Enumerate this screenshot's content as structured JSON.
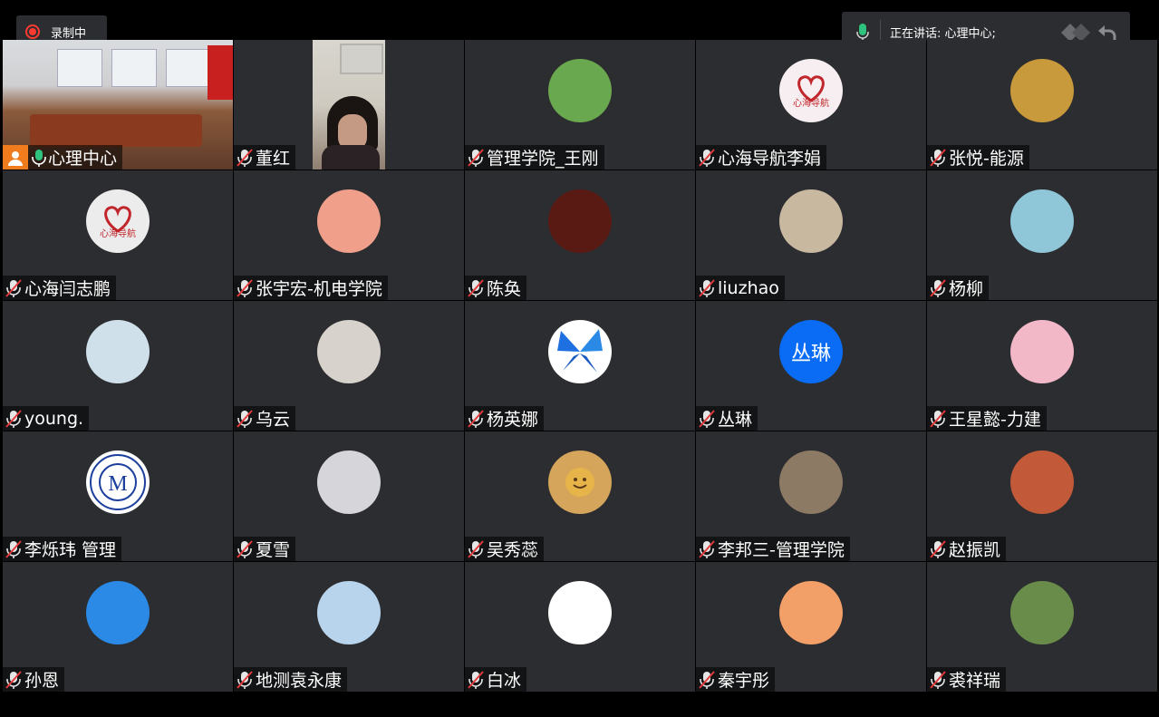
{
  "recording": {
    "label": "录制中"
  },
  "speaking": {
    "label": "正在讲话: 心理中心;"
  },
  "participants": [
    {
      "name": "心理中心",
      "mic": "on",
      "host": true,
      "kind": "video-room"
    },
    {
      "name": "董红",
      "mic": "muted",
      "kind": "video-woman"
    },
    {
      "name": "管理学院_王刚",
      "mic": "muted",
      "avatar_color": "#6aa84f",
      "kind": "avatar"
    },
    {
      "name": "心海导航李娟",
      "mic": "muted",
      "avatar_color": "#f6eef0",
      "kind": "avatar-logo",
      "logo_text": "心海导航"
    },
    {
      "name": "张悦-能源",
      "mic": "muted",
      "avatar_color": "#c89a3c",
      "kind": "avatar"
    },
    {
      "name": "心海闫志鹏",
      "mic": "muted",
      "avatar_color": "#ececec",
      "kind": "avatar-logo",
      "logo_text": "心海导航"
    },
    {
      "name": "张宇宏-机电学院",
      "mic": "muted",
      "avatar_color": "#f0a08a",
      "kind": "avatar"
    },
    {
      "name": "陈奂",
      "mic": "muted",
      "avatar_color": "#5a1a14",
      "kind": "avatar"
    },
    {
      "name": "liuzhao",
      "mic": "muted",
      "avatar_color": "#c8b8a0",
      "kind": "avatar"
    },
    {
      "name": "杨柳",
      "mic": "muted",
      "avatar_color": "#8fc6d8",
      "kind": "avatar"
    },
    {
      "name": "young.",
      "mic": "muted",
      "avatar_color": "#cfe0ea",
      "kind": "avatar"
    },
    {
      "name": "乌云",
      "mic": "muted",
      "avatar_color": "#d8d2cc",
      "kind": "avatar"
    },
    {
      "name": "杨英娜",
      "mic": "muted",
      "avatar_color": "#ffffff",
      "kind": "avatar-butterfly"
    },
    {
      "name": "丛琳",
      "mic": "muted",
      "avatar_color": "#0a6cf5",
      "kind": "letters",
      "letters": "丛琳"
    },
    {
      "name": "王星懿-力建",
      "mic": "muted",
      "avatar_color": "#f2b8c8",
      "kind": "avatar"
    },
    {
      "name": "李烁玮 管理",
      "mic": "muted",
      "avatar_color": "#ffffff",
      "kind": "avatar-seal"
    },
    {
      "name": "夏雪",
      "mic": "muted",
      "avatar_color": "#d6d6da",
      "kind": "avatar"
    },
    {
      "name": "吴秀蕊",
      "mic": "muted",
      "avatar_color": "#d4a55a",
      "kind": "avatar-smiley"
    },
    {
      "name": "李邦三-管理学院",
      "mic": "muted",
      "avatar_color": "#8c7a64",
      "kind": "avatar"
    },
    {
      "name": "赵振凯",
      "mic": "muted",
      "avatar_color": "#c25a3a",
      "kind": "avatar"
    },
    {
      "name": "孙恩",
      "mic": "muted",
      "avatar_color": "#2a8ae6",
      "kind": "avatar"
    },
    {
      "name": "地测袁永康",
      "mic": "muted",
      "avatar_color": "#b8d4ec",
      "kind": "avatar"
    },
    {
      "name": "白冰",
      "mic": "muted",
      "avatar_color": "#ffffff",
      "kind": "avatar"
    },
    {
      "name": "秦宇彤",
      "mic": "muted",
      "avatar_color": "#f2a068",
      "kind": "avatar"
    },
    {
      "name": "裘祥瑞",
      "mic": "muted",
      "avatar_color": "#6a8c4a",
      "kind": "avatar"
    }
  ]
}
